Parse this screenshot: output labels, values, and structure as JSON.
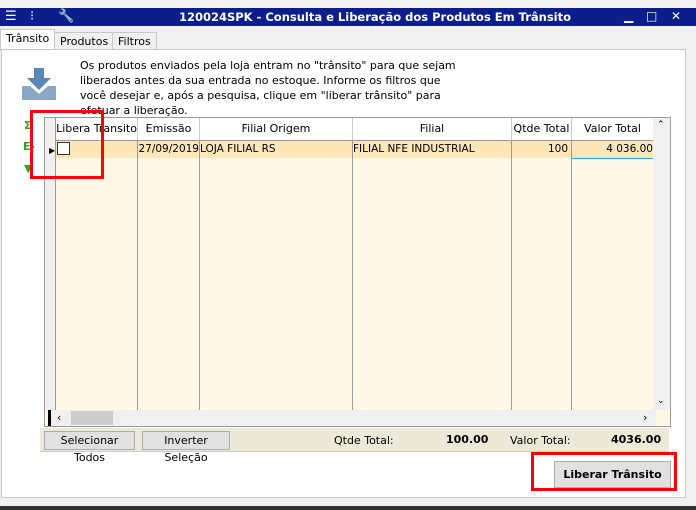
{
  "window": {
    "title": "120024SPK - Consulta e Liberação dos Produtos Em Trânsito",
    "icons": [
      "menu-icon",
      "traffic-light-icon",
      "wrench-icon"
    ],
    "controls": [
      "minimize",
      "maximize",
      "close"
    ]
  },
  "tabs": [
    {
      "label": "Trânsito",
      "active": true
    },
    {
      "label": "Produtos"
    },
    {
      "label": "Filtros"
    }
  ],
  "description": "Os produtos enviados pela loja entram no \"trânsito\" para que sejam liberados antes da sua entrada no estoque. Informe os filtros que você desejar e, após a pesquisa, clique em \"liberar trânsito\" para efetuar a liberação.",
  "grid": {
    "columns": [
      "Libera Transito",
      "Emissão",
      "Filial Origem",
      "Filial",
      "Qtde Total",
      "Valor Total"
    ],
    "rows": [
      {
        "libera": false,
        "emissao": "27/09/2019",
        "origem": "LOJA FILIAL RS",
        "filial": "FILIAL NFE INDUSTRIAL",
        "qtde": "100",
        "valor": "4 036.00"
      }
    ]
  },
  "footer": {
    "select_all": "Selecionar Todos",
    "invert": "Inverter Seleção",
    "qtde_label": "Qtde Total:",
    "qtde_value": "100.00",
    "valor_label": "Valor Total:",
    "valor_value": "4036.00"
  },
  "liberar_button": "Liberar Trânsito",
  "colors": {
    "titlebar": "#0b1e8c",
    "row_selected": "#fde6b8",
    "grid_bg": "#fff8e7",
    "highlight": "#ff0000"
  }
}
